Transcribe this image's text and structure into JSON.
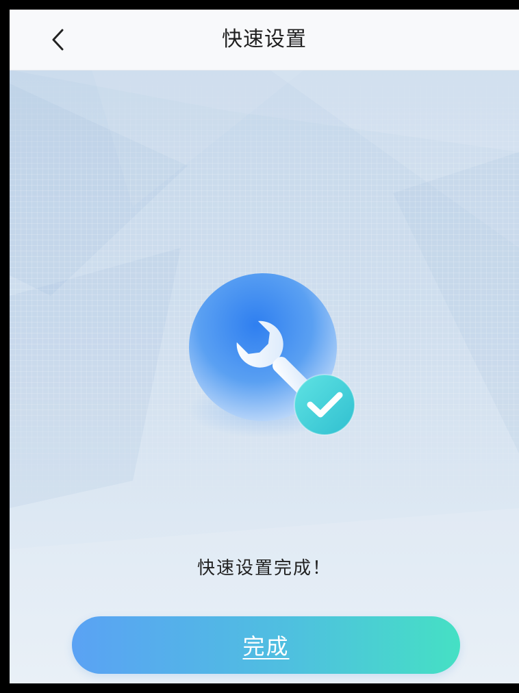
{
  "header": {
    "title": "快速设置",
    "back_icon": "chevron-left-icon"
  },
  "main": {
    "hero_icon": "wrench-icon",
    "badge_icon": "checkmark-icon",
    "status_text": "快速设置完成！"
  },
  "footer": {
    "done_label": "完成"
  },
  "colors": {
    "button_start": "#5aa2f4",
    "button_end": "#45e0c4",
    "icon_blue": "#3d8af0",
    "badge_teal": "#3fd2d6"
  }
}
